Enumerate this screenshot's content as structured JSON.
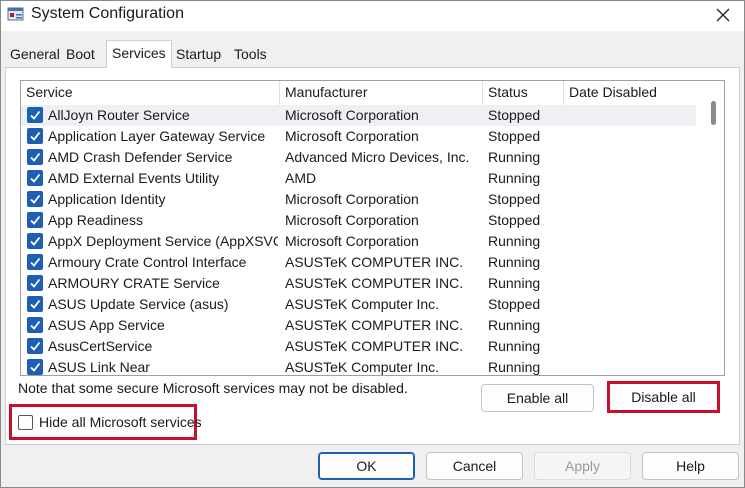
{
  "window": {
    "title": "System Configuration"
  },
  "tabs": [
    "General",
    "Boot",
    "Services",
    "Startup",
    "Tools"
  ],
  "active_tab": "Services",
  "list": {
    "columns": [
      "Service",
      "Manufacturer",
      "Status",
      "Date Disabled"
    ],
    "rows": [
      {
        "service": "AllJoyn Router Service",
        "manufacturer": "Microsoft Corporation",
        "status": "Stopped",
        "date_disabled": "",
        "checked": true
      },
      {
        "service": "Application Layer Gateway Service",
        "manufacturer": "Microsoft Corporation",
        "status": "Stopped",
        "date_disabled": "",
        "checked": true
      },
      {
        "service": "AMD Crash Defender Service",
        "manufacturer": "Advanced Micro Devices, Inc.",
        "status": "Running",
        "date_disabled": "",
        "checked": true
      },
      {
        "service": "AMD External Events Utility",
        "manufacturer": "AMD",
        "status": "Running",
        "date_disabled": "",
        "checked": true
      },
      {
        "service": "Application Identity",
        "manufacturer": "Microsoft Corporation",
        "status": "Stopped",
        "date_disabled": "",
        "checked": true
      },
      {
        "service": "App Readiness",
        "manufacturer": "Microsoft Corporation",
        "status": "Stopped",
        "date_disabled": "",
        "checked": true
      },
      {
        "service": "AppX Deployment Service (AppXSVC)",
        "manufacturer": "Microsoft Corporation",
        "status": "Running",
        "date_disabled": "",
        "checked": true
      },
      {
        "service": "Armoury Crate Control Interface",
        "manufacturer": "ASUSTeK COMPUTER INC.",
        "status": "Running",
        "date_disabled": "",
        "checked": true
      },
      {
        "service": "ARMOURY CRATE Service",
        "manufacturer": "ASUSTeK COMPUTER INC.",
        "status": "Running",
        "date_disabled": "",
        "checked": true
      },
      {
        "service": "ASUS Update Service (asus)",
        "manufacturer": "ASUSTeK Computer Inc.",
        "status": "Stopped",
        "date_disabled": "",
        "checked": true
      },
      {
        "service": "ASUS App Service",
        "manufacturer": "ASUSTeK COMPUTER INC.",
        "status": "Running",
        "date_disabled": "",
        "checked": true
      },
      {
        "service": "AsusCertService",
        "manufacturer": "ASUSTeK COMPUTER INC.",
        "status": "Running",
        "date_disabled": "",
        "checked": true
      },
      {
        "service": "ASUS Link Near",
        "manufacturer": "ASUSTeK Computer Inc.",
        "status": "Running",
        "date_disabled": "",
        "checked": true
      }
    ]
  },
  "note": "Note that some secure Microsoft services may not be disabled.",
  "buttons": {
    "enable_all": "Enable all",
    "disable_all": "Disable all",
    "ok": "OK",
    "cancel": "Cancel",
    "apply": "Apply",
    "help": "Help"
  },
  "hide_ms": {
    "label": "Hide all Microsoft services",
    "checked": false
  },
  "colors": {
    "highlight": "#c8102e",
    "checkbox": "#1e5fb4"
  },
  "icons": {
    "close": "close-icon",
    "app": "msconfig-icon",
    "check": "checkmark-icon"
  }
}
